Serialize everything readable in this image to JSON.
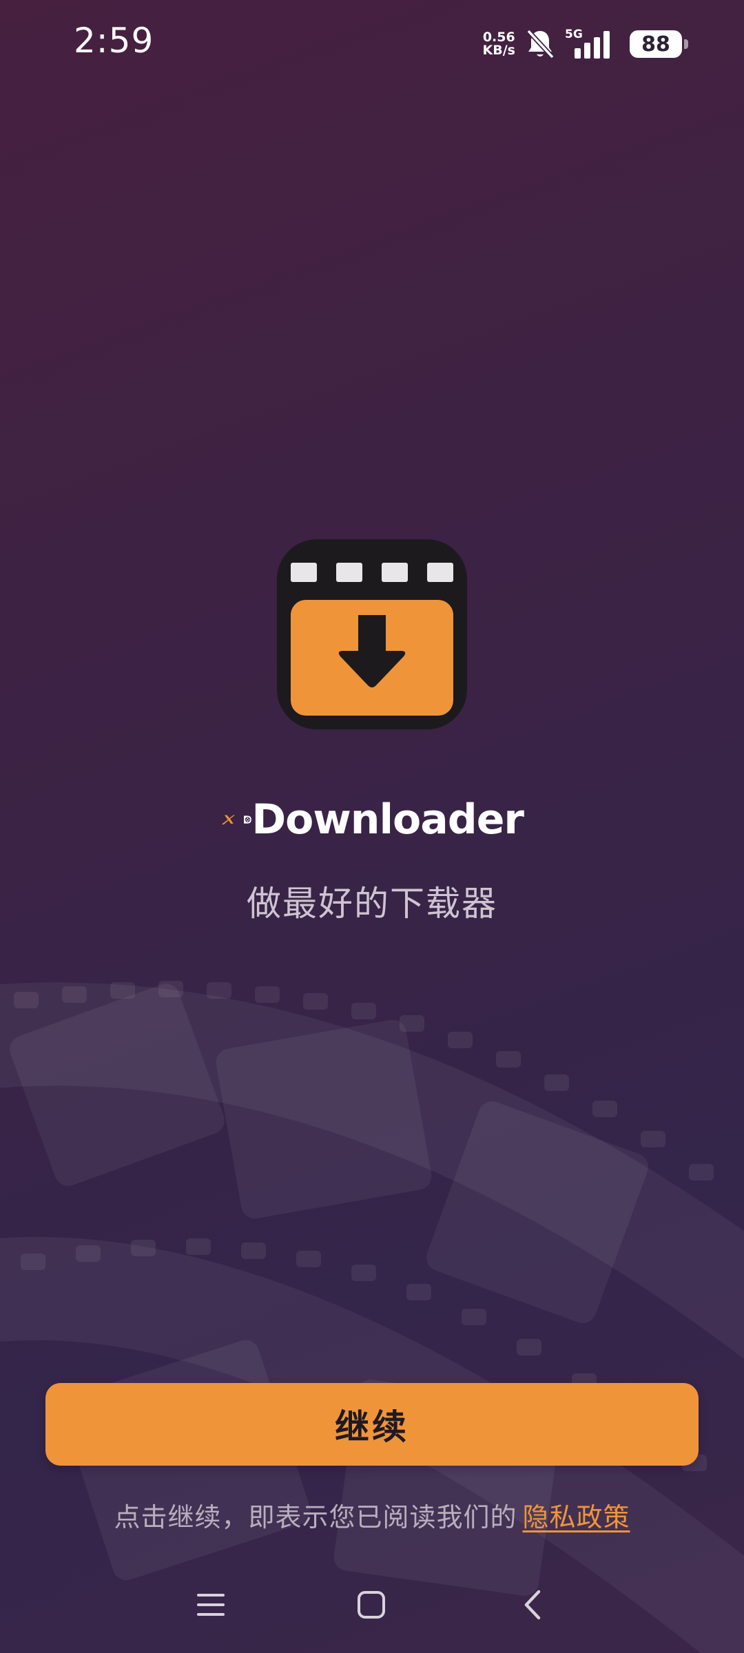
{
  "status_bar": {
    "time": "2:59",
    "net_speed_value": "0.56",
    "net_speed_unit": "KB/s",
    "network_type": "5G",
    "battery_level": "88",
    "icons": [
      "bell-muted-icon",
      "signal-icon",
      "battery-icon"
    ]
  },
  "brand": {
    "name": "Downloader",
    "tagline": "做最好的下载器"
  },
  "actions": {
    "continue_label": "继续"
  },
  "consent": {
    "text": "点击继续，即表示您已阅读我们的",
    "link_label": "隐私政策"
  },
  "nav": {
    "icons": [
      "menu-icon",
      "home-icon",
      "back-icon"
    ]
  },
  "colors": {
    "accent": "#f0943a",
    "logo_dark": "#1c1a1d",
    "background_top": "#47203f",
    "background_bottom": "#34254a"
  }
}
